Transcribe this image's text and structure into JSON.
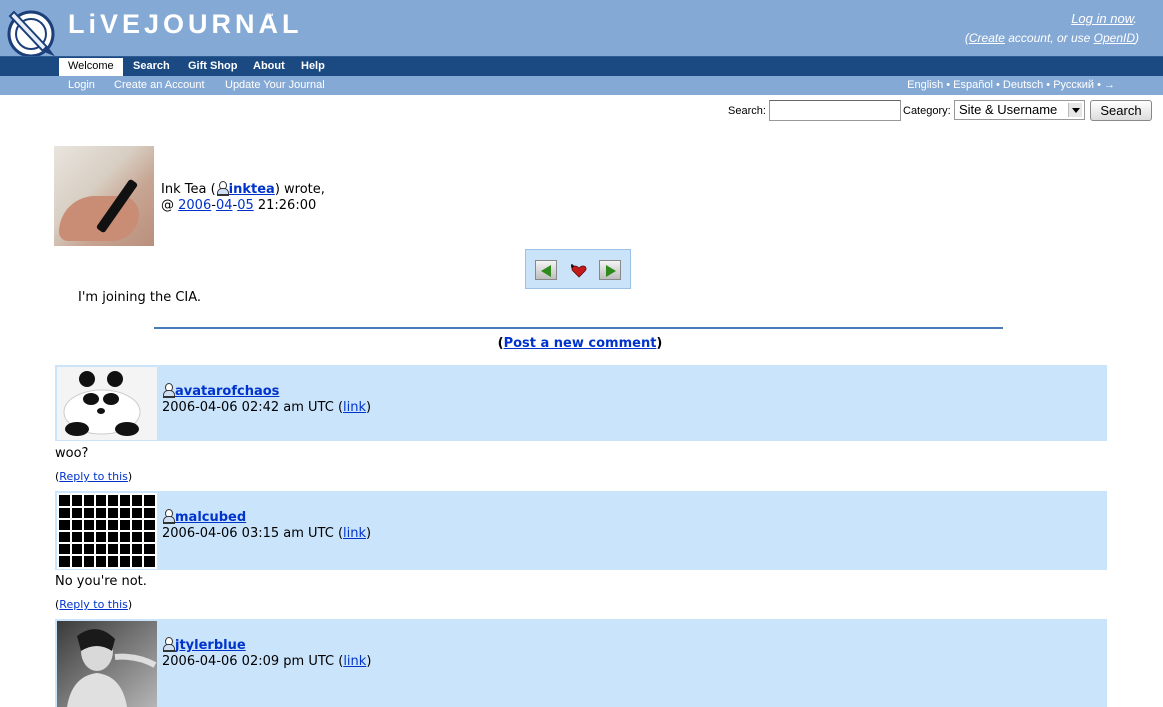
{
  "header": {
    "logo_text": "LiVEJOURNAL",
    "logo_tm": "™",
    "login_now": "Log in now",
    "login_now_suffix": ".",
    "sub_open": "(",
    "create_link": "Create",
    "sub_middle": " account, or use ",
    "openid_link": "OpenID",
    "sub_close": ")"
  },
  "nav": {
    "tabs": [
      "Welcome",
      "Search",
      "Gift Shop",
      "About",
      "Help"
    ]
  },
  "subnav": {
    "items": [
      "Login",
      "Create an Account",
      "Update Your Journal"
    ],
    "languages": "English • Español • Deutsch • Русский • →"
  },
  "search": {
    "label": "Search:",
    "value": "",
    "category_label": "Category:",
    "category_value": "Site & Username",
    "button": "Search"
  },
  "entry": {
    "author_name": "Ink Tea (",
    "author_user": "inktea",
    "author_suffix": ") wrote,",
    "at": "@ ",
    "year": "2006",
    "month": "04",
    "day": "05",
    "time": " 21:26:00",
    "dash": "-",
    "text": "I'm joining the CIA."
  },
  "post_comment": {
    "open": "(",
    "label": "Post a new comment",
    "close": ")"
  },
  "comments": [
    {
      "username": "avatarofchaos",
      "timestamp": "2006-04-06 02:42 am UTC (",
      "link": "link",
      "close": ")",
      "body": "woo?",
      "reply": "Reply to this"
    },
    {
      "username": "malcubed",
      "timestamp": "2006-04-06 03:15 am UTC (",
      "link": "link",
      "close": ")",
      "body": "No you're not.",
      "reply": "Reply to this"
    },
    {
      "username": "jtylerblue",
      "timestamp": "2006-04-06 02:09 pm UTC (",
      "link": "link",
      "close": ")"
    }
  ],
  "colors": {
    "header_bg": "#85a9d5",
    "nav_bg": "#1b4a82",
    "comment_bg": "#cae4fb",
    "link": "#0033cc"
  }
}
